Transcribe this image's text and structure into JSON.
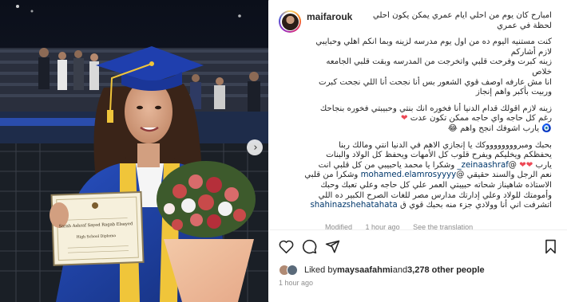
{
  "post": {
    "username": "maifarouk",
    "caption_lines": [
      "امبارح كان يوم من احلي ايام عمري يمكن يكون أحلي",
      "لحظة في عمري"
    ],
    "para2": [
      "كنت مستنيه اليوم ده من اول يوم مدرسه لزينه وبما انكم اهلي وحبايبي",
      "لازم أشاركم",
      "زينه كبرت وفرحت قلبي واتخرجت من المدرسه وبقت قلبي الجامعه",
      "خلاص",
      "انا مش عارفه اوصف قوي الشعور بس أنا نجحت أنا اللي نجحت كبرت",
      "وربيت بأكبر واهم إنجاز"
    ],
    "para3": [
      "زينه لازم اقولك قدام الدنيا أنا فخوره انك بنتي وحبيبتي فخوره بنجاحك",
      "رغم كل حاجه واي حاجه ممكن تكون عدت",
      "يارب اشوفك انجح واهم"
    ],
    "para4": [
      "بحبك ومبرووووووووكك يا إنجازي الاهم في الدنيا انتي ومالك ربنا",
      "يحفظكم ويخليكم ويفرح قلوب كل الأمهات ويحفظ كل الولاد والبنات",
      "يارب",
      "وشكرا يا محمد ياحبيبي من كل قلبي انت",
      "zeinaashraf_",
      "نعم الرجل والسند حقيقي",
      "وشكرا من قلبي",
      "mohamed.elamrosyyyy",
      "الاستاذه شاهيناز شحاته حبيبتي العمر علي كل حاجه وعلي تعبك وحبك",
      "وأمومتك للولاد وعلي إدارتك مدارس مصر للغات الصرح الكبير ده اللي",
      "اتشرفت اني أنا وولادي جزء منه بحبك قوي ق",
      "shahinazshehatahata"
    ],
    "meta": {
      "edited": "Modified",
      "ago": "1 hour ago",
      "translation": "See the translation"
    },
    "likes": {
      "prefix": "Liked by ",
      "user": "maysaafahmi",
      "and": "and ",
      "count": "3,278 other people"
    },
    "time": "1 hour ago"
  },
  "diploma": {
    "line1": "Sarah Ashraf Sayed Ragab Elsayed",
    "line2": "High School Diploma"
  },
  "icons": [
    "heart-icon",
    "comment-icon",
    "share-icon",
    "bookmark-icon",
    "chevron-right-icon"
  ],
  "colors": {
    "mention": "#00376b",
    "heart": "#ed4956",
    "secondary": "#8e8e8e",
    "gown": "#1e3a8a"
  }
}
